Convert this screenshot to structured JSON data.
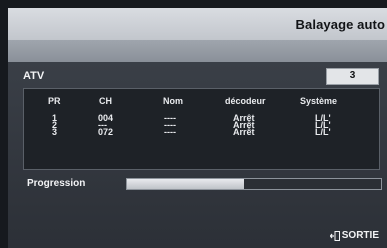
{
  "window": {
    "title": "Balayage auto"
  },
  "atv": {
    "label": "ATV",
    "count": "3"
  },
  "table": {
    "columns": [
      "PR",
      "CH",
      "Nom",
      "décodeur",
      "Système"
    ],
    "rows": [
      {
        "pr": "1",
        "ch": "004",
        "nom": "----",
        "decodeur": "Arrêt",
        "systeme": "L/L'"
      },
      {
        "pr": "2",
        "ch": "---",
        "nom": "----",
        "decodeur": "Arrêt",
        "systeme": "L/L'"
      },
      {
        "pr": "3",
        "ch": "072",
        "nom": "----",
        "decodeur": "Arrêt",
        "systeme": "L/L'"
      }
    ]
  },
  "progress": {
    "label": "Progression",
    "fraction": 0.46
  },
  "footer": {
    "exit_label": "SORTIE",
    "exit_icon": "exit-icon"
  }
}
